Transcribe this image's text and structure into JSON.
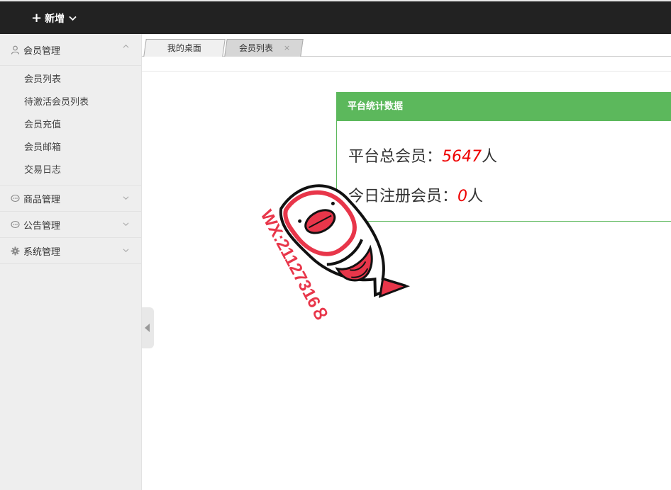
{
  "topbar": {
    "add_label": "新增"
  },
  "sidebar": {
    "groups": [
      {
        "label": "会员管理",
        "icon": "user-icon",
        "expanded": true,
        "items": [
          "会员列表",
          "待激活会员列表",
          "会员充值",
          "会员邮箱",
          "交易日志"
        ]
      },
      {
        "label": "商品管理",
        "icon": "chat-icon",
        "expanded": false
      },
      {
        "label": "公告管理",
        "icon": "chat-icon",
        "expanded": false
      },
      {
        "label": "系统管理",
        "icon": "gear-icon",
        "expanded": false
      }
    ]
  },
  "tabs": [
    {
      "label": "我的桌面",
      "active": true
    },
    {
      "label": "会员列表",
      "active": false,
      "close": "×"
    }
  ],
  "stats_panel": {
    "title": "平台统计数据",
    "total_label": "平台总会员：",
    "total_value": "5647",
    "total_unit": "人",
    "today_label": "今日注册会员：",
    "today_value": "0",
    "today_unit": "人"
  },
  "watermark": {
    "text": "WX:21127316８"
  },
  "colors": {
    "topbar": "#222222",
    "panel_green": "#5cb85c",
    "stat_red": "#e00000",
    "watermark_red": "#e8364a"
  }
}
